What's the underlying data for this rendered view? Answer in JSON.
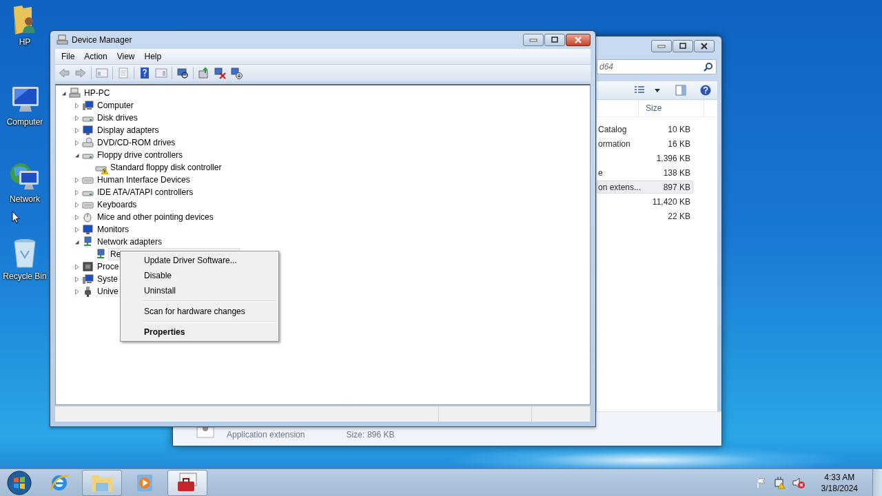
{
  "desktop": {
    "icons": [
      {
        "label": "HP"
      },
      {
        "label": "Computer"
      },
      {
        "label": "Network"
      },
      {
        "label": "Recycle Bin"
      }
    ]
  },
  "explorer_window": {
    "search": {
      "value": "d64"
    },
    "columns": [
      "Size"
    ],
    "rows": [
      {
        "name": "Catalog",
        "size": "10 KB",
        "selected": false
      },
      {
        "name": "ormation",
        "size": "16 KB",
        "selected": false
      },
      {
        "size": "1,396 KB",
        "selected": false
      },
      {
        "name": "e",
        "size": "138 KB",
        "selected": false
      },
      {
        "name": "on extens...",
        "size": "897 KB",
        "selected": true
      },
      {
        "size": "11,420 KB",
        "selected": false
      },
      {
        "size": "22 KB",
        "selected": false
      }
    ],
    "details": {
      "type": "Application extension",
      "size_label": "Size:",
      "size": "896 KB"
    }
  },
  "device_manager": {
    "title": "Device Manager",
    "menu": [
      "File",
      "Action",
      "View",
      "Help"
    ],
    "tree": {
      "label": "HP-PC",
      "expanded": true,
      "selected": false,
      "children": [
        {
          "label": "Computer",
          "expanded": false,
          "selected": false
        },
        {
          "label": "Disk drives",
          "expanded": false,
          "selected": false
        },
        {
          "label": "Display adapters",
          "expanded": false,
          "selected": false
        },
        {
          "label": "DVD/CD-ROM drives",
          "expanded": false,
          "selected": false
        },
        {
          "label": "Floppy drive controllers",
          "expanded": true,
          "selected": false,
          "children": [
            {
              "label": "Standard floppy disk controller",
              "selected": false,
              "warning": true
            }
          ]
        },
        {
          "label": "Human Interface Devices",
          "expanded": false,
          "selected": false
        },
        {
          "label": "IDE ATA/ATAPI controllers",
          "expanded": false,
          "selected": false
        },
        {
          "label": "Keyboards",
          "expanded": false,
          "selected": false
        },
        {
          "label": "Mice and other pointing devices",
          "expanded": false,
          "selected": false
        },
        {
          "label": "Monitors",
          "expanded": false,
          "selected": false
        },
        {
          "label": "Network adapters",
          "expanded": true,
          "selected": false,
          "children": [
            {
              "label": "Re",
              "selected": true,
              "warning": false
            }
          ]
        },
        {
          "label": "Proce",
          "expanded": false,
          "selected": false
        },
        {
          "label": "Syste",
          "expanded": false,
          "selected": false
        },
        {
          "label": "Unive",
          "expanded": false,
          "selected": false
        }
      ]
    },
    "context_menu": [
      {
        "kind": "item",
        "label": "Update Driver Software...",
        "default": false
      },
      {
        "kind": "item",
        "label": "Disable",
        "default": false
      },
      {
        "kind": "item",
        "label": "Uninstall",
        "default": false
      },
      {
        "kind": "separator"
      },
      {
        "kind": "item",
        "label": "Scan for hardware changes",
        "default": false
      },
      {
        "kind": "separator"
      },
      {
        "kind": "item",
        "label": "Properties",
        "default": true
      }
    ]
  },
  "taskbar": {
    "buttons": [
      {
        "open": false,
        "active": false
      },
      {
        "open": true,
        "active": false
      },
      {
        "open": false,
        "active": false
      },
      {
        "open": true,
        "active": true
      }
    ],
    "clock": {
      "time": "4:33 AM",
      "date": "3/18/2024"
    }
  }
}
